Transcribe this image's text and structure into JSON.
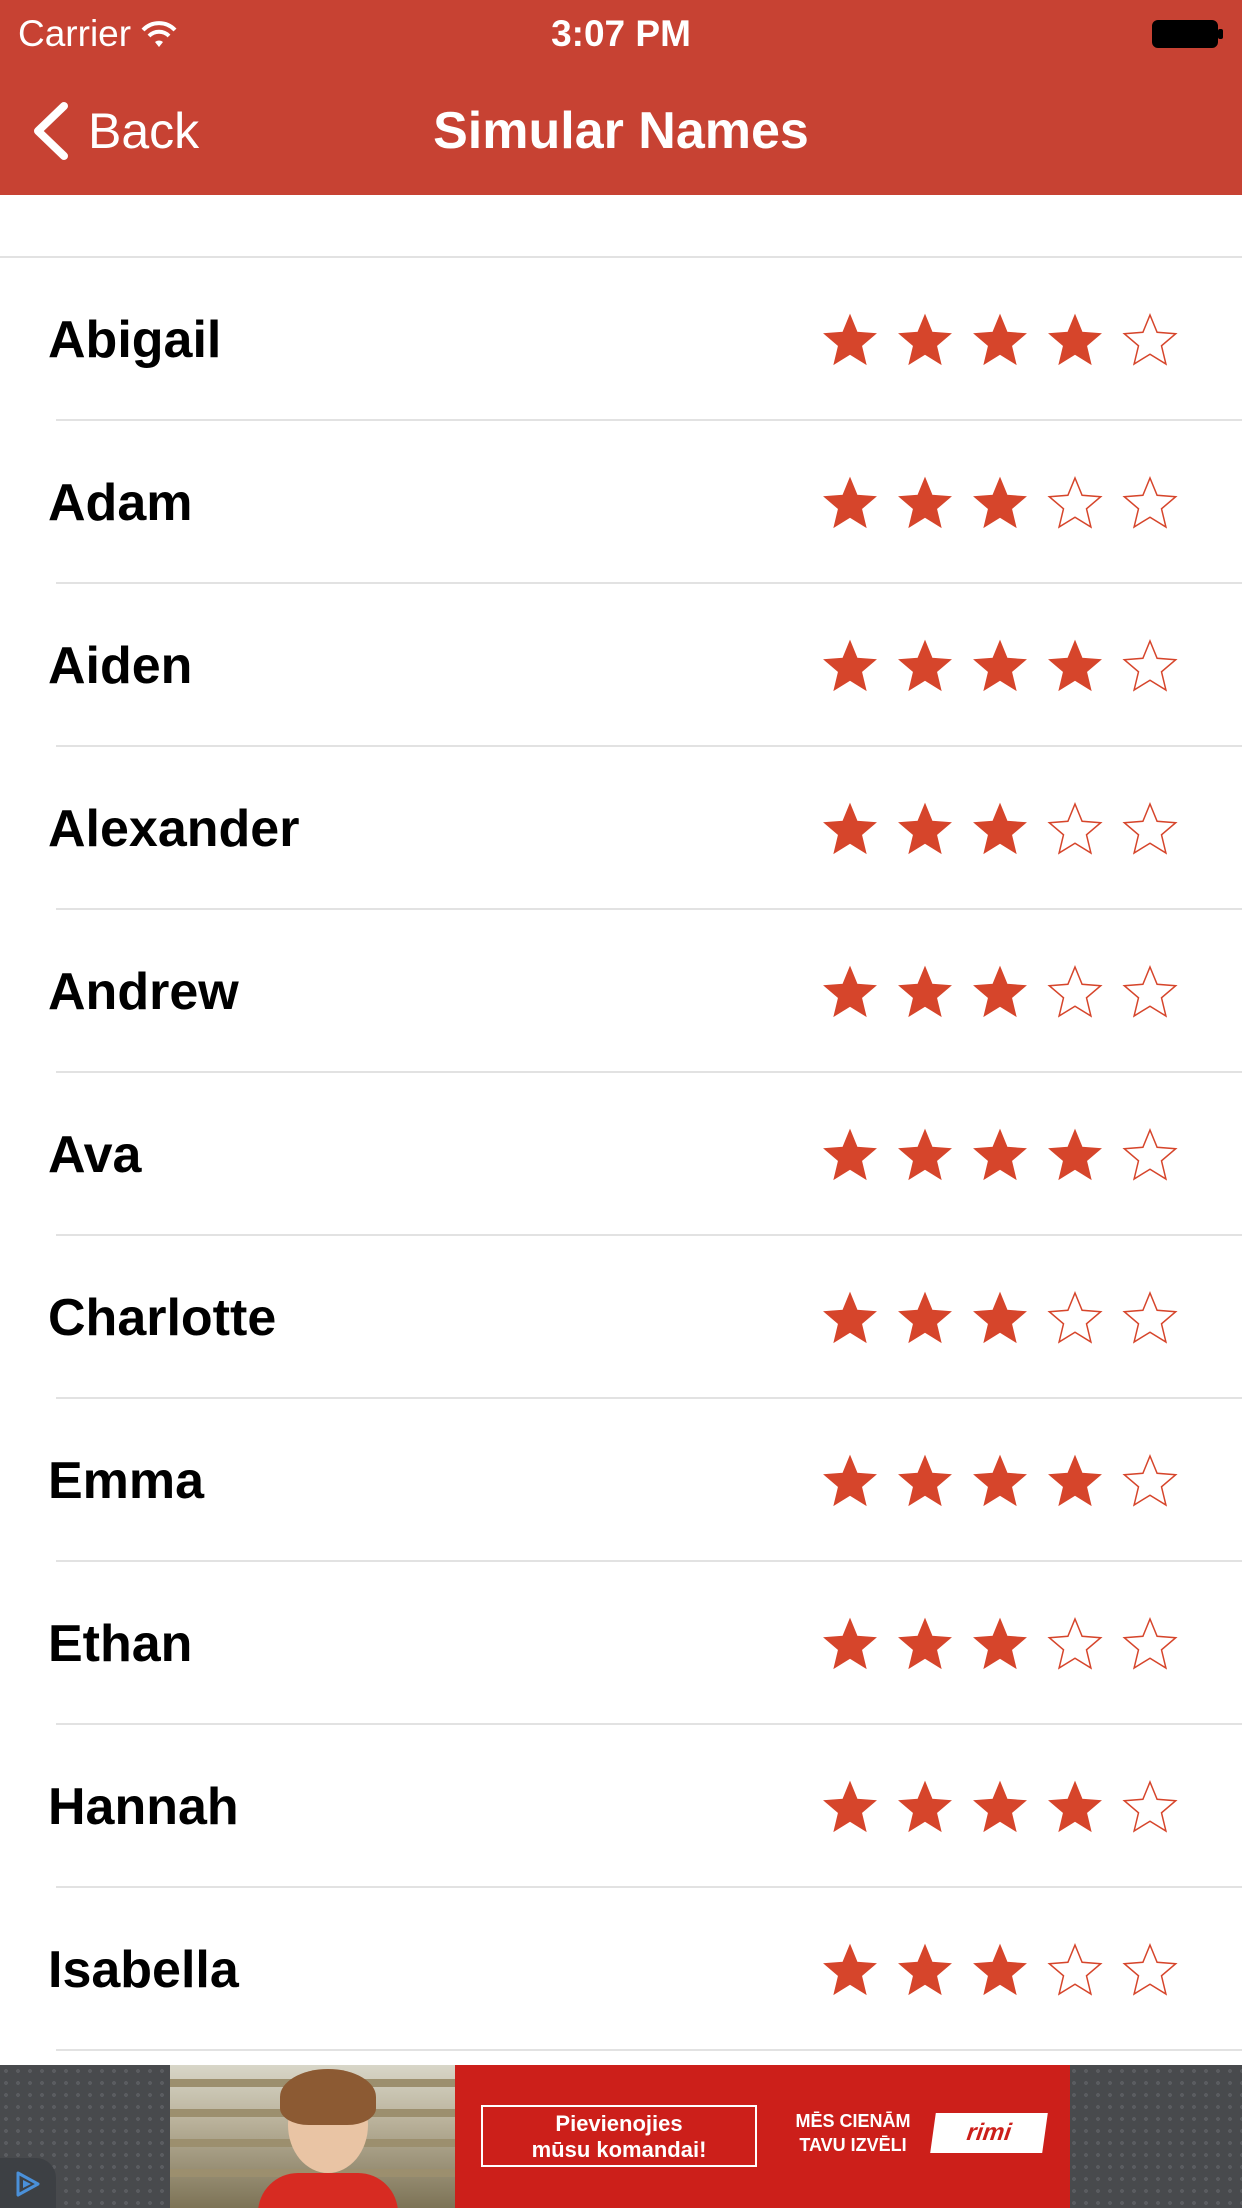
{
  "status_bar": {
    "carrier": "Carrier",
    "time": "3:07 PM"
  },
  "nav": {
    "back_label": "Back",
    "title": "Simular Names"
  },
  "colors": {
    "accent": "#c74233",
    "star": "#d6452b"
  },
  "names": [
    {
      "name": "Abigail",
      "rating": 4
    },
    {
      "name": "Adam",
      "rating": 3
    },
    {
      "name": "Aiden",
      "rating": 4
    },
    {
      "name": "Alexander",
      "rating": 3
    },
    {
      "name": "Andrew",
      "rating": 3
    },
    {
      "name": "Ava",
      "rating": 4
    },
    {
      "name": "Charlotte",
      "rating": 3
    },
    {
      "name": "Emma",
      "rating": 4
    },
    {
      "name": "Ethan",
      "rating": 3
    },
    {
      "name": "Hannah",
      "rating": 4
    },
    {
      "name": "Isabella",
      "rating": 3
    }
  ],
  "max_rating": 5,
  "ad": {
    "cta_line1": "Pievienojies",
    "cta_line2": "mūsu komandai!",
    "slogan_line1": "MĒS CIENĀM",
    "slogan_line2": "TAVU IZVĒLI",
    "logo": "rimi"
  }
}
